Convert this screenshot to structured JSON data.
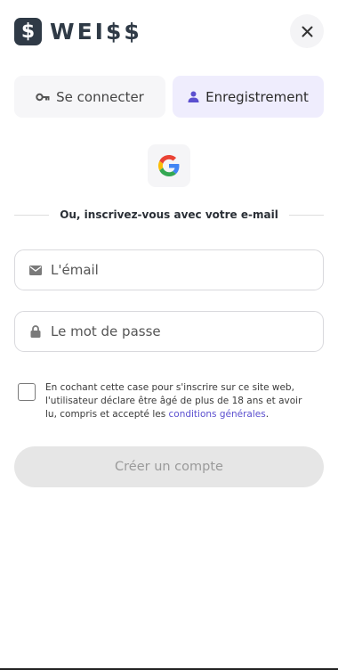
{
  "brand": {
    "mark": "$",
    "name": "WEI$$"
  },
  "tabs": [
    {
      "label": "Se connecter",
      "icon": "key-icon",
      "active": false
    },
    {
      "label": "Enregistrement",
      "icon": "user-icon",
      "active": true
    }
  ],
  "social": {
    "google_icon": "google-icon"
  },
  "divider": {
    "text": "Ou, inscrivez-vous avec votre e-mail"
  },
  "fields": {
    "email": {
      "placeholder": "L'émail",
      "value": "",
      "icon": "envelope-icon"
    },
    "password": {
      "placeholder": "Le mot de passe",
      "value": "",
      "icon": "lock-icon"
    }
  },
  "consent": {
    "checked": false,
    "text": "En cochant cette case pour s'inscrire sur ce site web, l'utilisateur déclare être âgé de plus de 18 ans et avoir lu, compris et accepté les ",
    "link": "conditions générales",
    "suffix": "."
  },
  "submit": {
    "label": "Créer un compte",
    "enabled": false
  },
  "colors": {
    "brand_dark": "#2f3a46",
    "accent": "#5b4fcf",
    "active_tab_bg": "#efedfd",
    "disabled_button": "#e6e6e6"
  }
}
